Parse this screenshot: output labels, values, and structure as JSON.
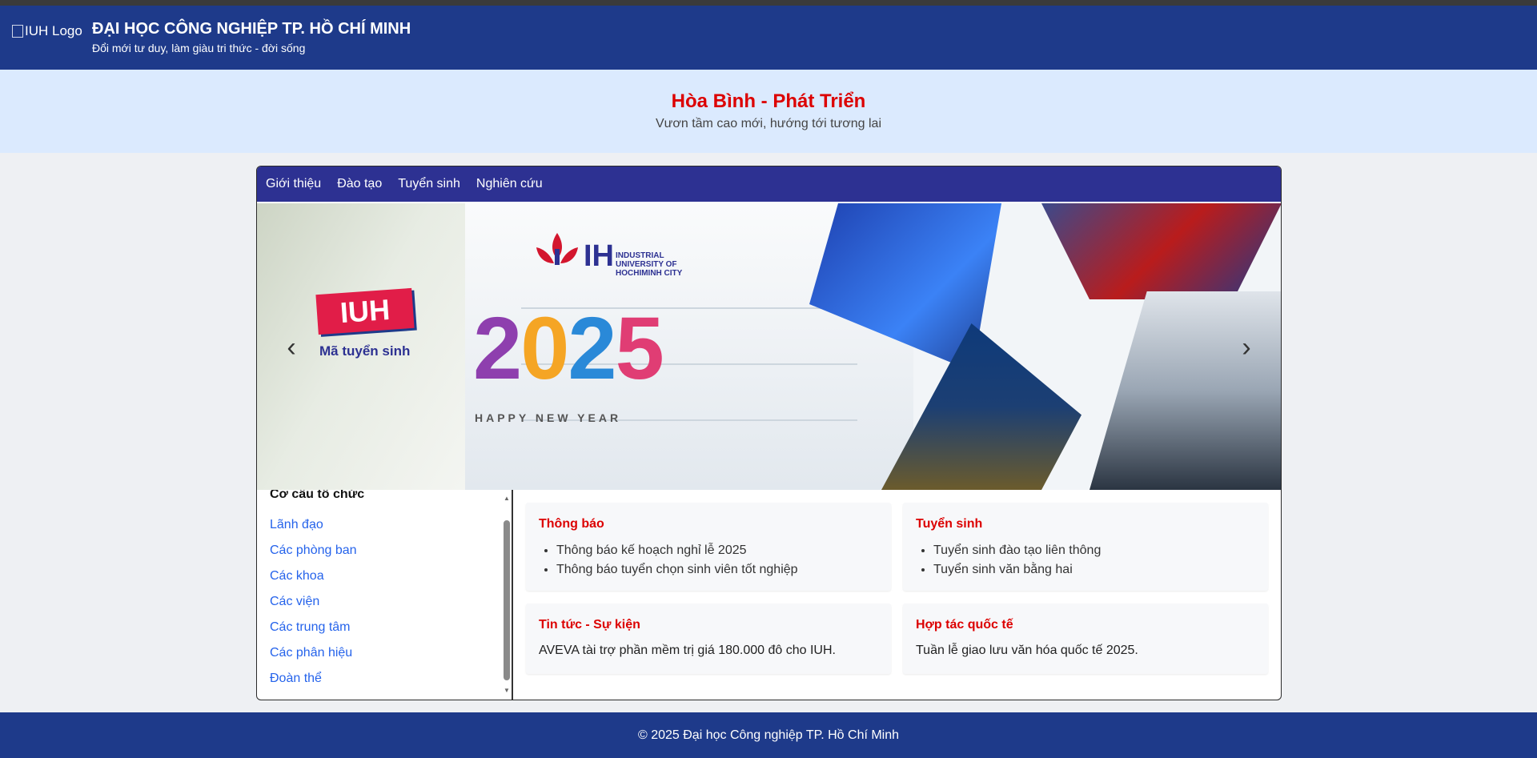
{
  "header": {
    "logo_alt": "IUH Logo",
    "title": "ĐẠI HỌC CÔNG NGHIỆP TP. HỒ CHÍ MINH",
    "subtitle": "Đổi mới tư duy, làm giàu tri thức - đời sống"
  },
  "hero": {
    "title": "Hòa Bình - Phát Triển",
    "subtitle": "Vươn tầm cao mới, hướng tới tương lai"
  },
  "nav": {
    "items": [
      "Giới thiệu",
      "Đào tạo",
      "Tuyển sinh",
      "Nghiên cứu"
    ]
  },
  "banner": {
    "badge": "IUH",
    "badge_caption": "Mã tuyển sinh",
    "logo_text": [
      "INDUSTRIAL",
      "UNIVERSITY OF",
      "HOCHIMINH CITY"
    ],
    "year_digits": [
      "2",
      "0",
      "2",
      "5"
    ],
    "tagline": "HAPPY NEW YEAR",
    "prev_icon": "chevron-left-icon",
    "next_icon": "chevron-right-icon"
  },
  "sidebar": {
    "heading": "Cơ cấu tổ chức",
    "items": [
      "Lãnh đạo",
      "Các phòng ban",
      "Các khoa",
      "Các viện",
      "Các trung tâm",
      "Các phân hiệu",
      "Đoàn thể"
    ]
  },
  "cards": {
    "announcements": {
      "title": "Thông báo",
      "items": [
        "Thông báo kế hoạch nghỉ lễ 2025",
        "Thông báo tuyển chọn sinh viên tốt nghiệp"
      ]
    },
    "admissions": {
      "title": "Tuyển sinh",
      "items": [
        "Tuyển sinh đào tạo liên thông",
        "Tuyển sinh văn bằng hai"
      ]
    },
    "news": {
      "title": "Tin tức - Sự kiện",
      "text": "AVEVA tài trợ phần mềm trị giá 180.000 đô cho IUH."
    },
    "international": {
      "title": "Hợp tác quốc tế",
      "text": "Tuần lễ giao lưu văn hóa quốc tế 2025."
    }
  },
  "footer": {
    "text": "© 2025 Đại học Công nghiệp TP. Hồ Chí Minh"
  },
  "colors": {
    "header_bg": "#1e3a8a",
    "nav_bg": "#2d3192",
    "accent_red": "#dc0000",
    "link_blue": "#2563eb",
    "hero_bg": "#dbeafe"
  }
}
